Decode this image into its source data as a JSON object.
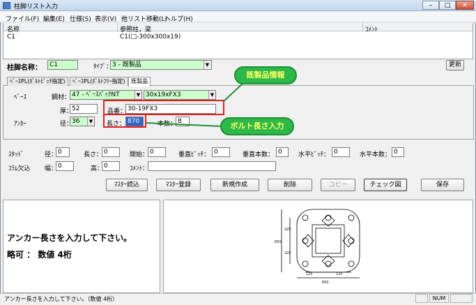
{
  "window": {
    "title": "柱脚リスト入力",
    "min": "–",
    "max": "□",
    "close": "✕"
  },
  "menu": [
    "ファイル(F)",
    "編集(E)",
    "仕様(S)",
    "表示(V)",
    "他リスト移動(L)",
    "ヘルプ(H)"
  ],
  "list": {
    "headers": [
      "名称",
      "参照柱，梁",
      "ｺﾒﾝﾄ"
    ],
    "row": [
      "C1",
      "C1(□-300x300x19)",
      ""
    ]
  },
  "form": {
    "name_label": "柱脚名称：",
    "name_value": "C1",
    "type_label": "ﾀｲﾌﾟ：",
    "type_value": "3 - 既製品",
    "update_button": "更新",
    "tabs": [
      "ﾍﾞｰｽPL(ﾎﾞﾙﾄﾋﾟｯﾁ指定)",
      "ﾍﾞｰｽPL(ﾎﾞﾙﾄﾌﾘｰ指定)",
      "既製品"
    ],
    "base_label": "ﾍﾞｰｽ",
    "steel_label": "鋼材：",
    "steel_value": "47 - ﾍﾞｰｽﾊﾟｯｸNT",
    "size_value": "30x19xFX3",
    "thick_label": "厚：",
    "thick_value": "52",
    "part_label": "品番：",
    "part_value": "30-19FX3",
    "anchor_label": "ｱﾝｶｰ",
    "dia_label": "径：",
    "dia_value": "36",
    "len_label": "長さ：",
    "len_value": "870",
    "count_label": "本数：",
    "count_value": "8",
    "stud_label": "ｽﾀｯﾄﾞ",
    "stud_dia": "径：",
    "stud_dia_value": "0",
    "stud_len": "長さ：",
    "stud_len_value": "0",
    "stud_start": "開始：",
    "stud_start_value": "0",
    "vpitch": "垂直ﾋﾟｯﾁ：",
    "vpitch_value": "0",
    "vcount": "垂直本数：",
    "vcount_value": "0",
    "hpitch": "水平ﾋﾟｯﾁ：",
    "hpitch_value": "0",
    "hcount": "水平本数：",
    "hcount_value": "0",
    "col_label": "ｺﾗﾑ欠込",
    "width_label": "幅：",
    "width_value": "0",
    "height_label": "高：",
    "height_value": "0",
    "comment_label": "ｺﾒﾝﾄ：",
    "comment_value": ""
  },
  "buttons": [
    "ﾏｽﾀｰ読込",
    "ﾏｽﾀｰ登録",
    "新規作成",
    "削除",
    "コピー",
    "チェック図",
    "保存"
  ],
  "callouts": {
    "top": "既製品情報",
    "bottom": "ボルト長さ入力"
  },
  "message": {
    "line1": "アンカー長さを入力して下さい。",
    "line2": "略可 ： 数値 4桁"
  },
  "drawing": {
    "dims": [
      "650",
      "225",
      "225",
      "225",
      "225",
      "125",
      "650",
      "125"
    ]
  },
  "status": {
    "text": "アンカー長さを入力して下さい。（数値 4桁）",
    "num": "NUM"
  }
}
